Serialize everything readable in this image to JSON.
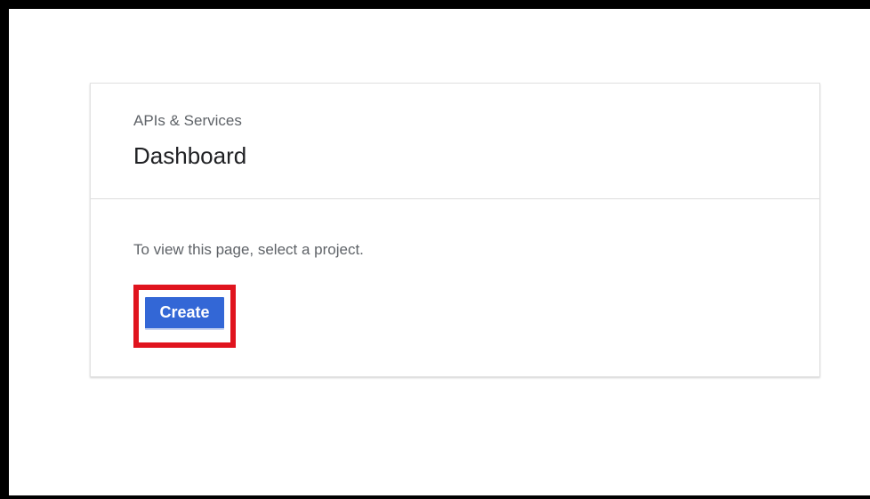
{
  "header": {
    "section_label": "APIs & Services",
    "page_title": "Dashboard"
  },
  "main": {
    "message": "To view this page, select a project.",
    "create_label": "Create"
  },
  "colors": {
    "button_bg": "#3367d6",
    "highlight_border": "#e0141e"
  }
}
